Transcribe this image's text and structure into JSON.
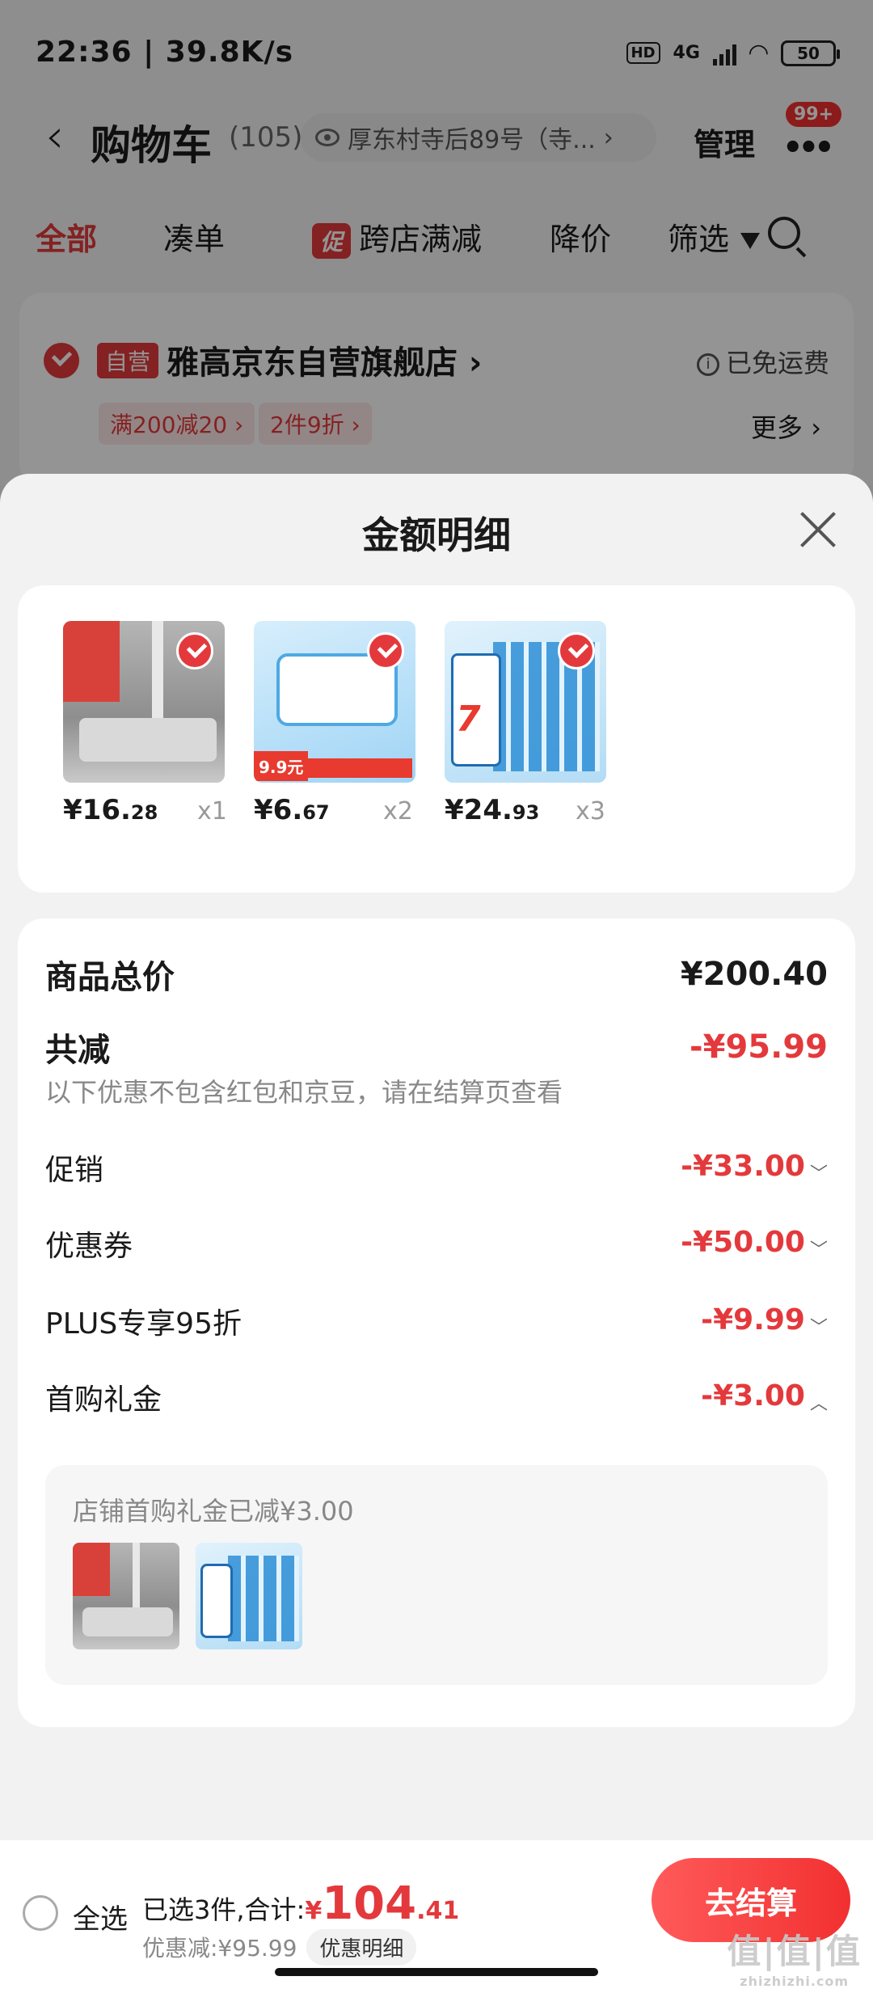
{
  "status_bar": {
    "time_speed": "22:36 | 39.8K/s",
    "hd": "HD",
    "network": "4G",
    "battery": "50"
  },
  "nav": {
    "back": "‹",
    "title": "购物车",
    "count": "(105)",
    "address": "厚东村寺后89号（寺...",
    "manage": "管理",
    "badge": "99+"
  },
  "tabs": {
    "all": "全部",
    "cou": "凑单",
    "promo_icon": "促",
    "cross_store": "跨店满减",
    "price_drop": "降价",
    "filter": "筛选"
  },
  "store": {
    "self_tag": "自营",
    "name": "雅高京东自营旗舰店 ›",
    "free_shipping": "已免运费",
    "coupons": [
      "满200减20 ›",
      "2件9折 ›"
    ],
    "more": "更多 ›"
  },
  "sheet": {
    "title": "金额明细",
    "products": [
      {
        "icon": "mop-product-image",
        "price_int": "¥16.",
        "price_dec": "28",
        "qty": "x1"
      },
      {
        "icon": "wipes-product-image",
        "price_int": "¥6.",
        "price_dec": "67",
        "qty": "x2",
        "tag": "9.9元"
      },
      {
        "icon": "tissue-product-image",
        "price_int": "¥24.",
        "price_dec": "93",
        "qty": "x3"
      }
    ],
    "total_label": "商品总价",
    "total_value": "¥200.40",
    "reduce_label": "共减",
    "reduce_value": "-¥95.99",
    "note": "以下优惠不包含红包和京豆，请在结算页查看",
    "items": [
      {
        "label": "促销",
        "value": "-¥33.00",
        "chev": "﹀"
      },
      {
        "label": "优惠券",
        "value": "-¥50.00",
        "chev": "﹀"
      },
      {
        "label": "PLUS专享95折",
        "value": "-¥9.99",
        "chev": "﹀"
      },
      {
        "label": "首购礼金",
        "value": "-¥3.00",
        "chev": "︿"
      }
    ],
    "gift_note": "店铺首购礼金已减¥3.00"
  },
  "bottom_bar": {
    "select_all": "全选",
    "summary_prefix": "已选3件,合计:",
    "currency": "¥",
    "total_int": "104",
    "total_dec": ".41",
    "discount": "优惠减:¥95.99",
    "detail_button": "优惠明细",
    "checkout": "去结算"
  },
  "watermark": {
    "text": "值|值|值",
    "sub": "zhizhizhi.com"
  },
  "colors": {
    "accent": "#e4393c",
    "button": "#f23030"
  }
}
